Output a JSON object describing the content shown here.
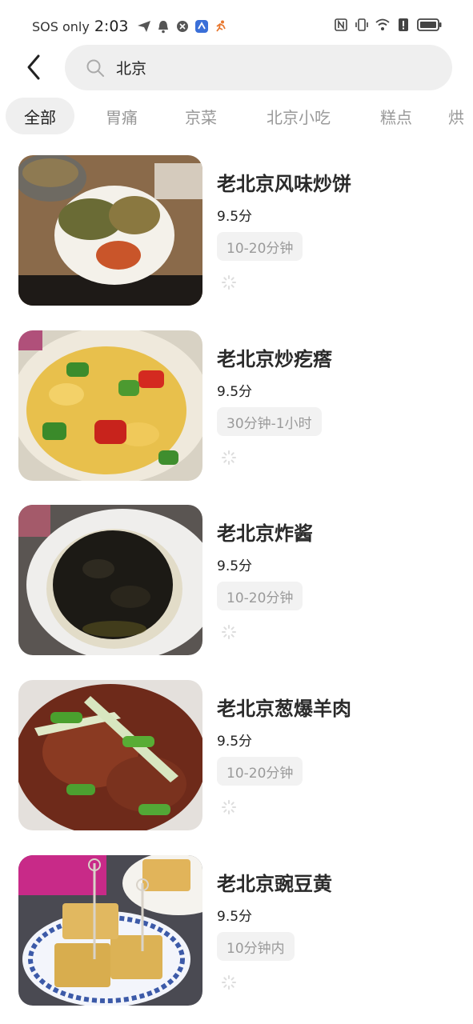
{
  "status_bar": {
    "carrier": "SOS only",
    "time": "2:03",
    "icons": [
      "send-icon",
      "bell-icon",
      "shield-icon",
      "app-icon",
      "runner-icon",
      "nfc-icon",
      "vibrate-icon",
      "wifi-icon",
      "sim-alert-icon",
      "battery-icon"
    ]
  },
  "header": {
    "back_icon": "chevron-left-icon",
    "search": {
      "value": "北京",
      "icon": "search-icon"
    }
  },
  "tabs": [
    {
      "label": "全部",
      "active": true
    },
    {
      "label": "胃痛",
      "active": false
    },
    {
      "label": "京菜",
      "active": false
    },
    {
      "label": "北京小吃",
      "active": false
    },
    {
      "label": "糕点",
      "active": false
    },
    {
      "label": "烘",
      "active": false
    }
  ],
  "recipes": [
    {
      "title": "老北京风味炒饼",
      "score": "9.5分",
      "time": "10-20分钟"
    },
    {
      "title": "老北京炒疙瘩",
      "score": "9.5分",
      "time": "30分钟-1小时"
    },
    {
      "title": "老北京炸酱",
      "score": "9.5分",
      "time": "10-20分钟"
    },
    {
      "title": "老北京葱爆羊肉",
      "score": "9.5分",
      "time": "10-20分钟"
    },
    {
      "title": "老北京豌豆黄",
      "score": "9.5分",
      "time": "10分钟内"
    }
  ],
  "colors": {
    "pill_bg": "#efefef",
    "muted_text": "#999999",
    "title_text": "#2a2a2a"
  }
}
